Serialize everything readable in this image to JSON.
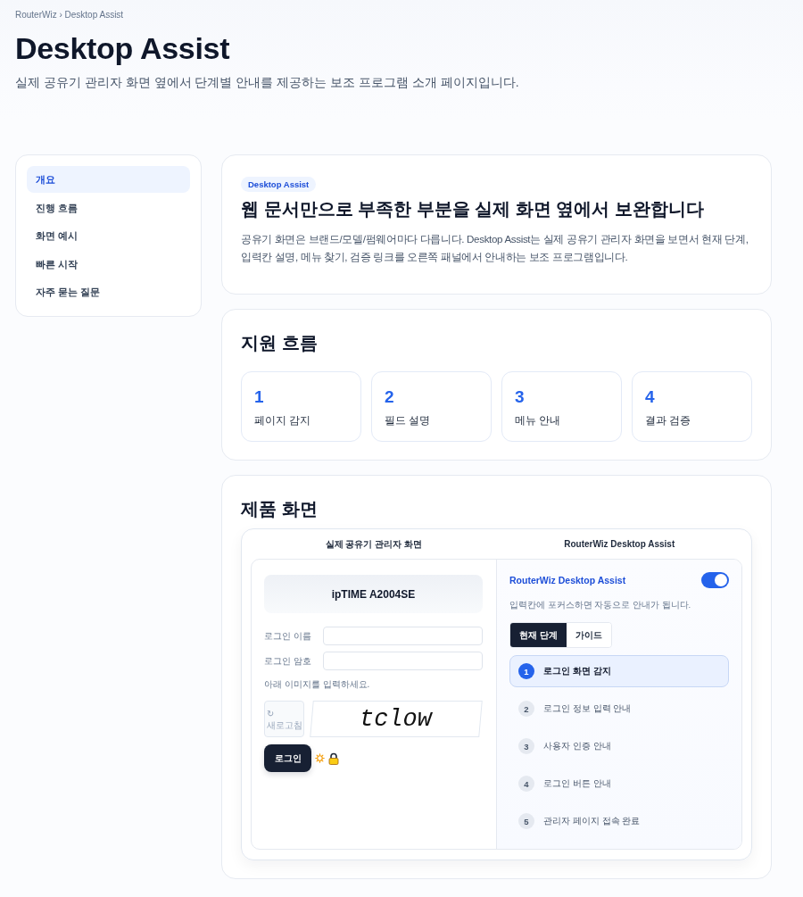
{
  "breadcrumb": "RouterWiz › Desktop Assist",
  "header": {
    "title": "Desktop Assist",
    "subtitle": "실제 공유기 관리자 화면 옆에서 단계별 안내를 제공하는 보조 프로그램 소개 페이지입니다."
  },
  "sidebar": {
    "items": [
      {
        "label": "개요",
        "selected": true
      },
      {
        "label": "진행 흐름",
        "selected": false
      },
      {
        "label": "화면 예시",
        "selected": false
      },
      {
        "label": "빠른 시작",
        "selected": false
      },
      {
        "label": "자주 묻는 질문",
        "selected": false
      }
    ]
  },
  "intro": {
    "badge": "Desktop Assist",
    "heading": "웹 문서만으로 부족한 부분을 실제 화면 옆에서 보완합니다",
    "body": "공유기 화면은 브랜드/모델/펌웨어마다 다릅니다. Desktop Assist는 실제 공유기 관리자 화면을 보면서 현재 단계, 입력칸 설명, 메뉴 찾기, 검증 링크를 오른쪽 패널에서 안내하는 보조 프로그램입니다."
  },
  "flow": {
    "heading": "지원 흐름",
    "steps": [
      {
        "number": "1",
        "label": "페이지 감지"
      },
      {
        "number": "2",
        "label": "필드 설명"
      },
      {
        "number": "3",
        "label": "메뉴 안내"
      },
      {
        "number": "4",
        "label": "결과 검증"
      }
    ]
  },
  "product": {
    "heading": "제품 화면",
    "columns": [
      "실제 공유기 관리자 화면",
      "RouterWiz Desktop Assist"
    ],
    "router": {
      "model": "ipTIME A2004SE",
      "fields": [
        {
          "label": "로그인 이름"
        },
        {
          "label": "로그인 암호"
        }
      ],
      "captcha_prompt": "아래 이미지를 입력하세요.",
      "refresh": {
        "icon": "↻",
        "label": "새로고침"
      },
      "captcha_text": "tclow",
      "login_button": "로그인"
    },
    "assist": {
      "title": "RouterWiz Desktop Assist",
      "enabled": true,
      "hint": "입력칸에 포커스하면 자동으로 안내가 됩니다.",
      "tabs": [
        {
          "label": "현재 단계",
          "selected": true
        },
        {
          "label": "가이드",
          "selected": false
        }
      ],
      "steps": [
        {
          "number": "1",
          "label": "로그인 화면 감지",
          "selected": true
        },
        {
          "number": "2",
          "label": "로그인 정보 입력 안내",
          "selected": false
        },
        {
          "number": "3",
          "label": "사용자 인증 안내",
          "selected": false
        },
        {
          "number": "4",
          "label": "로그인 버튼 안내",
          "selected": false
        },
        {
          "number": "5",
          "label": "관리자 페이지 접속 완료",
          "selected": false
        }
      ]
    }
  }
}
